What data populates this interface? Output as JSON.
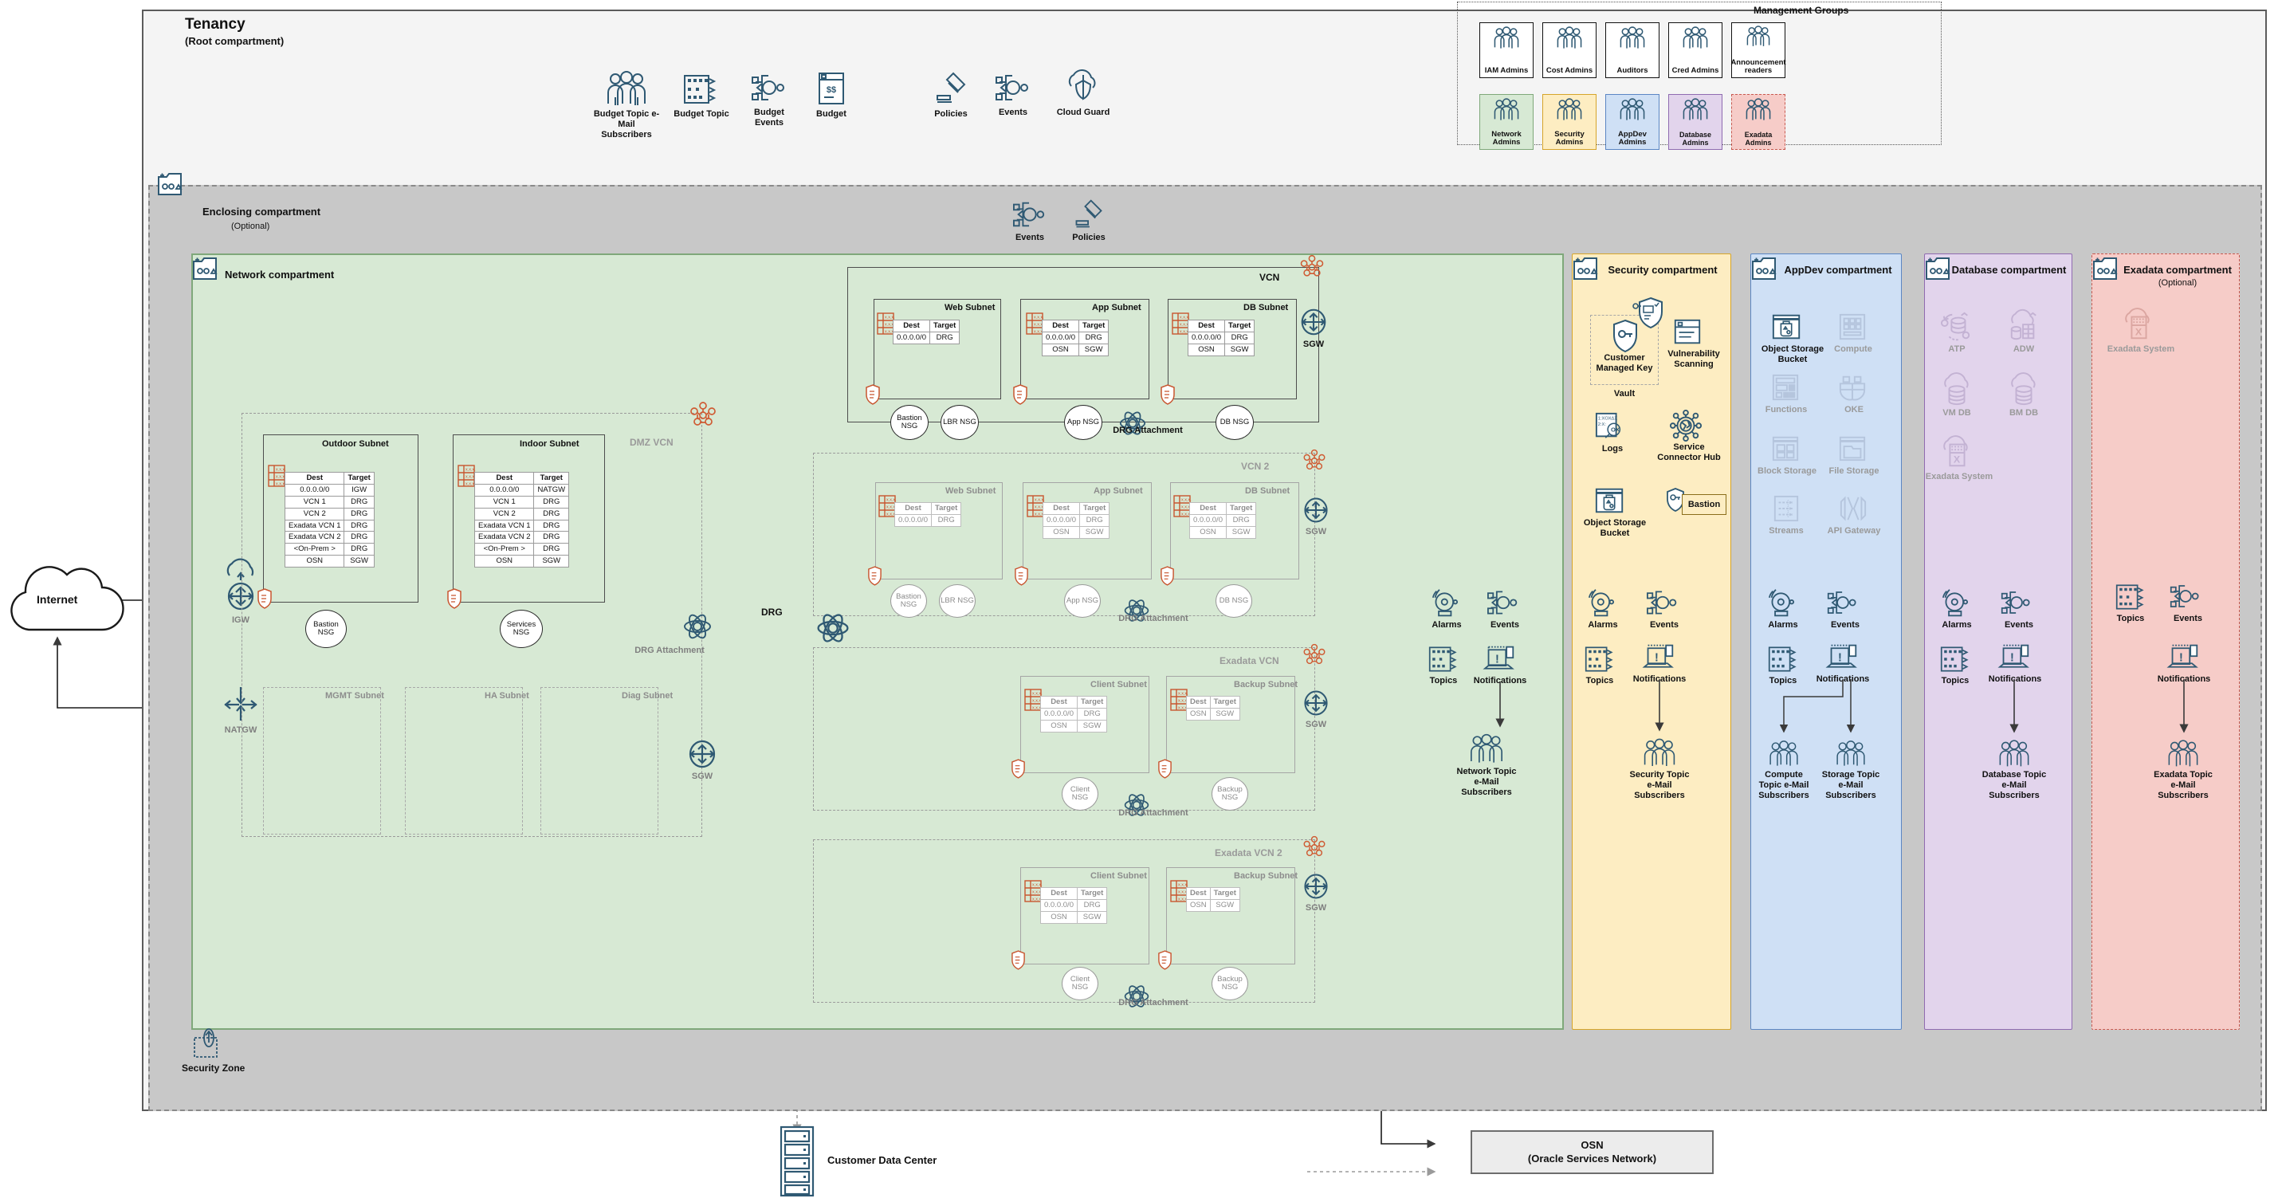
{
  "tenancy": {
    "title": "Tenancy",
    "subtitle": "(Root compartment)"
  },
  "enclosing": {
    "title": "Enclosing compartment",
    "subtitle": "(Optional)"
  },
  "network_compartment": {
    "title": "Network compartment"
  },
  "management_groups": {
    "title": "Management Groups",
    "row1": [
      {
        "label": "IAM Admins",
        "icon": "users-icon",
        "color": "#ffffff"
      },
      {
        "label": "Cost Admins",
        "icon": "users-icon",
        "color": "#ffffff"
      },
      {
        "label": "Auditors",
        "icon": "users-icon",
        "color": "#ffffff"
      },
      {
        "label": "Cred Admins",
        "icon": "users-icon",
        "color": "#ffffff"
      },
      {
        "label": "Announcement readers",
        "icon": "users-icon",
        "color": "#ffffff"
      }
    ],
    "row2": [
      {
        "label": "Network Admins",
        "icon": "users-icon",
        "color": "#d7e9d4",
        "border": "#7fa87a"
      },
      {
        "label": "Security Admins",
        "icon": "users-icon",
        "color": "#fdedc2",
        "border": "#d6a52a"
      },
      {
        "label": "AppDev Admins",
        "icon": "users-icon",
        "color": "#cfe0f5",
        "border": "#5b86c4"
      },
      {
        "label": "Database Admins",
        "icon": "users-icon",
        "color": "#e2d4ec",
        "border": "#8f6bb0"
      },
      {
        "label": "Exadata Admins",
        "icon": "users-icon",
        "color": "#f6ccc8",
        "border": "#c85a50"
      }
    ]
  },
  "tenancy_services": [
    {
      "label": "Budget Topic e-Mail Subscribers",
      "icon": "users-icon"
    },
    {
      "label": "Budget Topic",
      "icon": "topics-icon"
    },
    {
      "label": "Budget Events",
      "icon": "events-icon"
    },
    {
      "label": "Budget",
      "icon": "budget-icon"
    },
    {
      "label": "Policies",
      "icon": "policies-icon"
    },
    {
      "label": "Events",
      "icon": "events-icon"
    },
    {
      "label": "Cloud Guard",
      "icon": "cloud-guard-icon"
    }
  ],
  "enclosing_services": [
    {
      "label": "Events",
      "icon": "events-icon"
    },
    {
      "label": "Policies",
      "icon": "policies-icon"
    }
  ],
  "internet": {
    "label": "Internet",
    "icon": "cloud-icon"
  },
  "gateways": {
    "igw": "IGW",
    "natgw": "NATGW",
    "drg": "DRG",
    "sgw": "SGW",
    "drg_attachment": "DRG Attachment"
  },
  "vcns": [
    {
      "name": "DMZ VCN",
      "style": "dashed-grey",
      "subnets": [
        {
          "name": "Outdoor Subnet",
          "route_headers": [
            "Dest",
            "Target"
          ],
          "routes": [
            [
              "0.0.0.0/0",
              "IGW"
            ],
            [
              "VCN 1",
              "DRG"
            ],
            [
              "VCN 2",
              "DRG"
            ],
            [
              "Exadata VCN 1",
              "DRG"
            ],
            [
              "Exadata VCN 2",
              "DRG"
            ],
            [
              "<On-Prem >",
              "DRG"
            ],
            [
              "OSN",
              "SGW"
            ]
          ],
          "nsgs": [
            "Bastion NSG"
          ]
        },
        {
          "name": "Indoor Subnet",
          "route_headers": [
            "Dest",
            "Target"
          ],
          "routes": [
            [
              "0.0.0.0/0",
              "NATGW"
            ],
            [
              "VCN 1",
              "DRG"
            ],
            [
              "VCN 2",
              "DRG"
            ],
            [
              "Exadata VCN 1",
              "DRG"
            ],
            [
              "Exadata VCN 2",
              "DRG"
            ],
            [
              "<On-Prem >",
              "DRG"
            ],
            [
              "OSN",
              "SGW"
            ]
          ],
          "nsgs": [
            "Services NSG"
          ]
        }
      ],
      "empty_subnets": [
        "MGMT Subnet",
        "HA Subnet",
        "Diag Subnet"
      ]
    },
    {
      "name": "VCN",
      "style": "solid",
      "subnets": [
        {
          "name": "Web Subnet",
          "route_headers": [
            "Dest",
            "Target"
          ],
          "routes": [
            [
              "0.0.0.0/0",
              "DRG"
            ]
          ],
          "nsgs": [
            "Bastion NSG",
            "LBR NSG"
          ]
        },
        {
          "name": "App Subnet",
          "route_headers": [
            "Dest",
            "Target"
          ],
          "routes": [
            [
              "0.0.0.0/0",
              "DRG"
            ],
            [
              "OSN",
              "SGW"
            ]
          ],
          "nsgs": [
            "App NSG"
          ]
        },
        {
          "name": "DB Subnet",
          "route_headers": [
            "Dest",
            "Target"
          ],
          "routes": [
            [
              "0.0.0.0/0",
              "DRG"
            ],
            [
              "OSN",
              "SGW"
            ]
          ],
          "nsgs": [
            "DB NSG"
          ]
        }
      ]
    },
    {
      "name": "VCN 2",
      "style": "dashed-grey",
      "subnets": [
        {
          "name": "Web Subnet",
          "route_headers": [
            "Dest",
            "Target"
          ],
          "routes": [
            [
              "0.0.0.0/0",
              "DRG"
            ]
          ],
          "nsgs": [
            "Bastion NSG",
            "LBR NSG"
          ]
        },
        {
          "name": "App Subnet",
          "route_headers": [
            "Dest",
            "Target"
          ],
          "routes": [
            [
              "0.0.0.0/0",
              "DRG"
            ],
            [
              "OSN",
              "SGW"
            ]
          ],
          "nsgs": [
            "App NSG"
          ]
        },
        {
          "name": "DB Subnet",
          "route_headers": [
            "Dest",
            "Target"
          ],
          "routes": [
            [
              "0.0.0.0/0",
              "DRG"
            ],
            [
              "OSN",
              "SGW"
            ]
          ],
          "nsgs": [
            "DB NSG"
          ]
        }
      ]
    },
    {
      "name": "Exadata VCN",
      "style": "dashed-grey",
      "subnets": [
        {
          "name": "Client Subnet",
          "route_headers": [
            "Dest",
            "Target"
          ],
          "routes": [
            [
              "0.0.0.0/0",
              "DRG"
            ],
            [
              "OSN",
              "SGW"
            ]
          ],
          "nsgs": [
            "Client NSG"
          ]
        },
        {
          "name": "Backup Subnet",
          "route_headers": [
            "Dest",
            "Target"
          ],
          "routes": [
            [
              "OSN",
              "SGW"
            ]
          ],
          "nsgs": [
            "Backup NSG"
          ]
        }
      ]
    },
    {
      "name": "Exadata VCN 2",
      "style": "dashed-grey",
      "subnets": [
        {
          "name": "Client Subnet",
          "route_headers": [
            "Dest",
            "Target"
          ],
          "routes": [
            [
              "0.0.0.0/0",
              "DRG"
            ],
            [
              "OSN",
              "SGW"
            ]
          ],
          "nsgs": [
            "Client NSG"
          ]
        },
        {
          "name": "Backup Subnet",
          "route_headers": [
            "Dest",
            "Target"
          ],
          "routes": [
            [
              "OSN",
              "SGW"
            ]
          ],
          "nsgs": [
            "Backup NSG"
          ]
        }
      ]
    }
  ],
  "network_monitoring": [
    {
      "label": "Alarms",
      "icon": "alarm-icon"
    },
    {
      "label": "Events",
      "icon": "events-icon"
    },
    {
      "label": "Topics",
      "icon": "topics-icon"
    },
    {
      "label": "Notifications",
      "icon": "notifications-icon"
    },
    {
      "label": "Network Topic e-Mail Subscribers",
      "icon": "users-icon"
    }
  ],
  "security_compartment": {
    "title": "Security compartment",
    "vault_label": "Vault",
    "items": [
      {
        "label": "Customer Managed Key",
        "icon": "key-shield-icon"
      },
      {
        "label": "Vulnerability Scanning",
        "icon": "scanning-icon"
      },
      {
        "label": "Logs",
        "icon": "logs-icon"
      },
      {
        "label": "Service Connector Hub",
        "icon": "connector-hub-icon"
      },
      {
        "label": "Object Storage Bucket",
        "icon": "object-storage-icon"
      },
      {
        "label": "Bastion",
        "icon": "bastion-icon"
      }
    ],
    "monitoring": [
      {
        "label": "Alarms",
        "icon": "alarm-icon"
      },
      {
        "label": "Events",
        "icon": "events-icon"
      },
      {
        "label": "Topics",
        "icon": "topics-icon"
      },
      {
        "label": "Notifications",
        "icon": "notifications-icon"
      },
      {
        "label": "Security Topic e-Mail Subscribers",
        "icon": "users-icon"
      }
    ]
  },
  "appdev_compartment": {
    "title": "AppDev compartment",
    "items": [
      {
        "label": "Object Storage Bucket",
        "icon": "object-storage-icon",
        "dim": false
      },
      {
        "label": "Compute",
        "icon": "compute-icon",
        "dim": true
      },
      {
        "label": "Functions",
        "icon": "functions-icon",
        "dim": true
      },
      {
        "label": "OKE",
        "icon": "oke-icon",
        "dim": true
      },
      {
        "label": "Block Storage",
        "icon": "block-storage-icon",
        "dim": true
      },
      {
        "label": "File Storage",
        "icon": "file-storage-icon",
        "dim": true
      },
      {
        "label": "Streams",
        "icon": "streams-icon",
        "dim": true
      },
      {
        "label": "API Gateway",
        "icon": "api-gateway-icon",
        "dim": true
      }
    ],
    "monitoring": [
      {
        "label": "Alarms",
        "icon": "alarm-icon"
      },
      {
        "label": "Events",
        "icon": "events-icon"
      },
      {
        "label": "Topics",
        "icon": "topics-icon"
      },
      {
        "label": "Notifications",
        "icon": "notifications-icon"
      },
      {
        "label": "Compute Topic e-Mail Subscribers",
        "icon": "users-icon"
      },
      {
        "label": "Storage Topic e-Mail Subscribers",
        "icon": "users-icon"
      }
    ]
  },
  "database_compartment": {
    "title": "Database compartment",
    "items": [
      {
        "label": "ATP",
        "icon": "atp-icon",
        "dim": true
      },
      {
        "label": "ADW",
        "icon": "adw-icon",
        "dim": true
      },
      {
        "label": "VM DB",
        "icon": "vmdb-icon",
        "dim": true
      },
      {
        "label": "BM DB",
        "icon": "bmdb-icon",
        "dim": true
      },
      {
        "label": "Exadata System",
        "icon": "exadata-icon",
        "dim": true
      }
    ],
    "monitoring": [
      {
        "label": "Alarms",
        "icon": "alarm-icon"
      },
      {
        "label": "Events",
        "icon": "events-icon"
      },
      {
        "label": "Topics",
        "icon": "topics-icon"
      },
      {
        "label": "Notifications",
        "icon": "notifications-icon"
      },
      {
        "label": "Database Topic e-Mail Subscribers",
        "icon": "users-icon"
      }
    ]
  },
  "exadata_compartment": {
    "title": "Exadata compartment",
    "subtitle": "(Optional)",
    "items": [
      {
        "label": "Exadata System",
        "icon": "exadata-icon",
        "dim": true
      }
    ],
    "monitoring": [
      {
        "label": "Topics",
        "icon": "topics-icon"
      },
      {
        "label": "Events",
        "icon": "events-icon"
      },
      {
        "label": "Notifications",
        "icon": "notifications-icon"
      },
      {
        "label": "Exadata Topic e-Mail Subscribers",
        "icon": "users-icon"
      }
    ]
  },
  "security_zone": {
    "label": "Security Zone",
    "icon": "security-zone-icon"
  },
  "customer_data_center": {
    "label": "Customer Data Center",
    "icon": "server-rack-icon"
  },
  "osn": {
    "line1": "OSN",
    "line2": "(Oracle Services Network)"
  },
  "colors": {
    "network": "#d7e9d4",
    "security": "#fdedc2",
    "appdev": "#cfe0f5",
    "database": "#e2d4ec",
    "exadata": "#f6ccc8",
    "icon_blue": "#2f5973",
    "nsg_orange": "#d4613c"
  }
}
